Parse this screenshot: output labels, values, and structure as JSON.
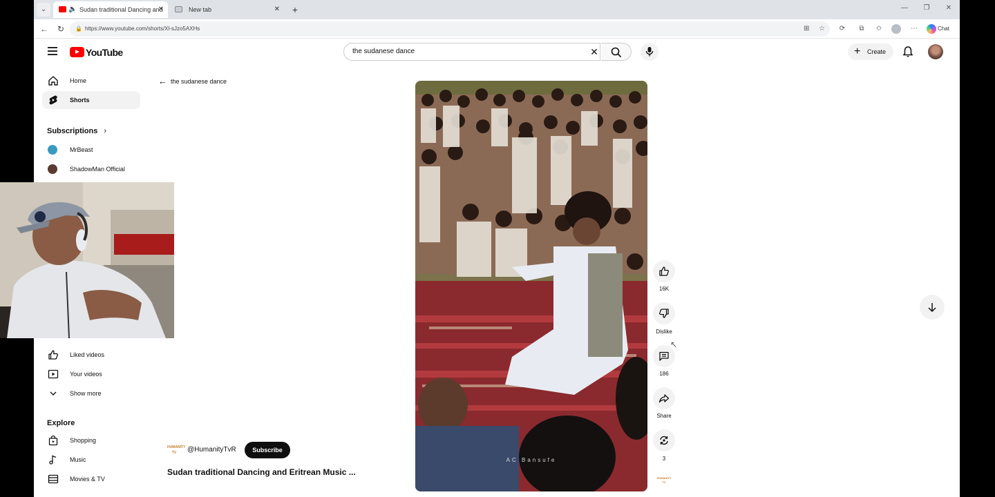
{
  "browser": {
    "tabs": [
      {
        "title": "Sudan traditional Dancing and",
        "active": true
      },
      {
        "title": "New tab",
        "active": false
      }
    ],
    "new_tab_label": "+",
    "url": "https://www.youtube.com/shorts/Xl-sJzo5AXHs",
    "copilot_label": "Chat"
  },
  "youtube": {
    "logo_text": "YouTube",
    "search": {
      "query": "the sudanese dance"
    },
    "create_label": "Create"
  },
  "sidebar": {
    "main": [
      {
        "label": "Home",
        "icon": "home-icon"
      },
      {
        "label": "Shorts",
        "icon": "shorts-icon",
        "active": true
      }
    ],
    "subscriptions_heading": "Subscriptions",
    "subscriptions": [
      {
        "label": "MrBeast",
        "color": "#3a9bbf"
      },
      {
        "label": "ShadowMan Official",
        "color": "#5a3a32"
      }
    ],
    "you": [
      {
        "label": "Liked videos",
        "icon": "thumbs-up-icon"
      },
      {
        "label": "Your videos",
        "icon": "play-box-icon"
      },
      {
        "label": "Show more",
        "icon": "chevron-down-icon"
      }
    ],
    "explore_heading": "Explore",
    "explore": [
      {
        "label": "Shopping",
        "icon": "shopping-bag-icon"
      },
      {
        "label": "Music",
        "icon": "music-note-icon"
      },
      {
        "label": "Movies & TV",
        "icon": "film-icon"
      }
    ]
  },
  "shorts": {
    "back_label": "the sudanese dance",
    "channel_name": "@HumanityTvR",
    "channel_thumb_text": "HUMANITY TV",
    "subscribe_label": "Subscribe",
    "title": "Sudan traditional Dancing and Eritrean Music ...",
    "watermark": "AC Bansufe",
    "actions": {
      "likes": "16K",
      "dislike_label": "Dislike",
      "comments": "186",
      "share_label": "Share",
      "remix": "3"
    }
  },
  "colors": {
    "brand_red": "#ff0000",
    "subscribe_bg": "#0f0f0f",
    "chip_bg": "#f2f2f2"
  }
}
